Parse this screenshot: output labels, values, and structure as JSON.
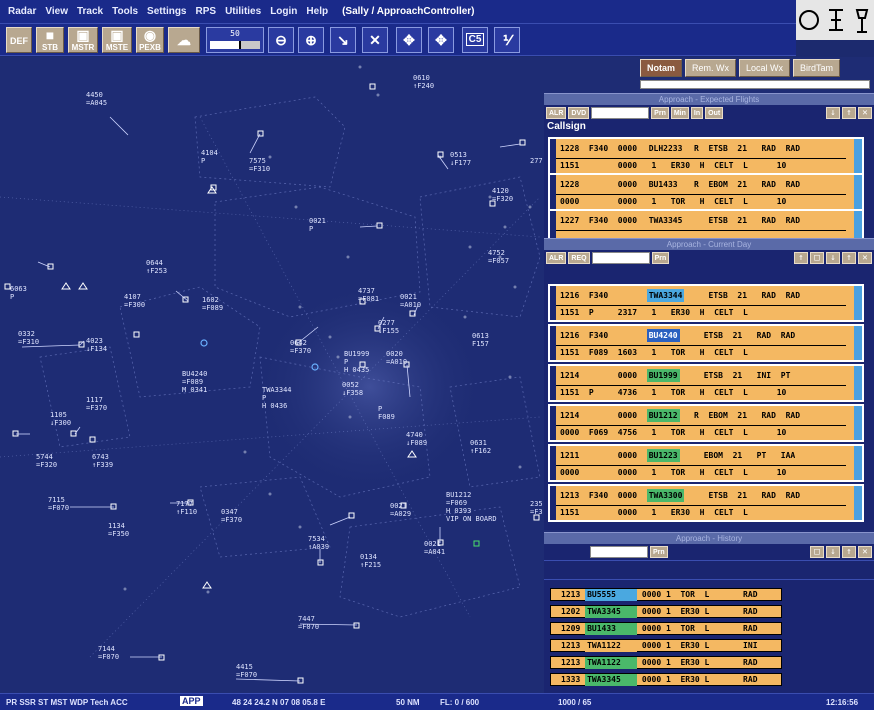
{
  "menu": {
    "items": [
      "Radar",
      "View",
      "Track",
      "Tools",
      "Settings",
      "RPS",
      "Utilities",
      "Login",
      "Help"
    ],
    "window_title": "(Sally / ApproachController)"
  },
  "toolbar": {
    "buttons": [
      {
        "label": "DEF",
        "icon": "def-icon"
      },
      {
        "label": "STB",
        "icon": "stb-icon"
      },
      {
        "label": "MSTR",
        "icon": "mstr-icon"
      },
      {
        "label": "MSTE",
        "icon": "mste-icon"
      },
      {
        "label": "PEXB",
        "icon": "pexb-icon"
      }
    ],
    "zoom_value": "50",
    "zoom_fraction": 0.62
  },
  "notam_bar": {
    "buttons": [
      "Notam",
      "Rem. Wx",
      "Local Wx",
      "BirdTam"
    ]
  },
  "expected": {
    "title": "Approach - Expected Flights",
    "buttons": [
      "ALR",
      "DVD",
      "Prn",
      "Min",
      "In",
      "Out"
    ],
    "callsign_header": "Callsign",
    "strips": [
      {
        "l1a": "1228  F340  0000  ",
        "callsign": "DLH2233",
        "l1b": "  R  ETSB  21   RAD  RAD",
        "l2": "1151        0000   1   ER30  H  CELT  L      10",
        "cs_style": "org"
      },
      {
        "l1a": "1228        0000  ",
        "callsign": "BU1433",
        "l1b": "   R  EBOM  21   RAD  RAD",
        "l2": "0000        0000   1   TOR   H  CELT  L      10",
        "cs_style": "org"
      },
      {
        "l1a": "1227  F340  0000  ",
        "callsign": "TWA3345",
        "l1b": "     ETSB  21   RAD  RAD",
        "l2": "",
        "cs_style": "org"
      }
    ]
  },
  "current": {
    "title": "Approach - Current Day",
    "buttons": [
      "ALR",
      "REQ",
      "Prn"
    ],
    "strips": [
      {
        "l1a": "1216  F340        ",
        "callsign": "TWA3344",
        "l1b": "     ETSB  21   RAD  RAD",
        "l2": "1151  P     2317   1   ER30  H  CELT  L",
        "cs_style": "blue"
      },
      {
        "l1a": "1216  F340        ",
        "callsign": "BU4240",
        "l1b": "     ETSB  21   RAD  RAD",
        "l2": "1151  F089  1603   1   TOR   H  CELT  L",
        "cs_style": "sel"
      },
      {
        "l1a": "1214        0000  ",
        "callsign": "BU1999",
        "l1b": "     ETSB  21   INI  PT",
        "l2": "1151  P     4736   1   TOR   H  CELT  L      10",
        "cs_style": "green"
      },
      {
        "l1a": "1214        0000  ",
        "callsign": "BU1212",
        "l1b": "   R  EBOM  21   RAD  RAD",
        "l2": "0000  F069  4756   1   TOR   H  CELT  L      10",
        "cs_style": "green"
      },
      {
        "l1a": "1211        0000  ",
        "callsign": "BU1223",
        "l1b": "     EBOM  21   PT   IAA",
        "l2": "0000        0000   1   TOR   H  CELT  L      10",
        "cs_style": "green"
      },
      {
        "l1a": "1213  F340  0000  ",
        "callsign": "TWA3300",
        "l1b": "     ETSB  21   RAD  RAD",
        "l2": "1151        0000   1   ER30  H  CELT  L",
        "cs_style": "green"
      }
    ]
  },
  "history": {
    "title": "Approach - History",
    "buttons": [
      "Prn"
    ],
    "rows": [
      {
        "time": "1213",
        "callsign": "BU5555",
        "rest": " 0000 1  TOR  L       RAD",
        "style": ""
      },
      {
        "time": "1202",
        "callsign": "TWA3345",
        "rest": " 0000 1  ER30 L       RAD",
        "style": "green"
      },
      {
        "time": "1209",
        "callsign": "BU1433",
        "rest": " 0000 1  TOR  L       RAD",
        "style": "green"
      },
      {
        "time": "1213",
        "callsign": "TWA1122",
        "rest": " 0000 1  ER30 L       INI",
        "style": "org"
      },
      {
        "time": "1213",
        "callsign": "TWA1122",
        "rest": " 0000 1  ER30 L       RAD",
        "style": "green"
      },
      {
        "time": "1333",
        "callsign": "TWA3345",
        "rest": " 0000 1  ER30 L       RAD",
        "style": "green"
      }
    ]
  },
  "radar_tags": [
    "4450\n=A045",
    "0610\n↑F240",
    "4104\nP",
    "7575\n=F310",
    "0513\n↓F177",
    "277",
    "4120\n=F320",
    "0021\nP",
    "4752\n=F057",
    "0644\n↑F253",
    "4107\n=F300",
    "1602\n=F089",
    "4737\n=F081",
    "0021\n=A010",
    "6063\nP",
    "0332\n=F310",
    "4023\n↓F134",
    "0277\n↓F155",
    "0613\nF157",
    "0642\n=F370",
    "BU1999\nP\nH 0435",
    "0020\n=A010",
    "BU4240\n=F089\nM 0341",
    "TWA3344\nP\nH 0436",
    "0052\n↓F358",
    "P\nF089",
    "1117\n=F370",
    "1105\n↓F300",
    "4740\n↓F089",
    "5744\n=F320",
    "6743\n↑F339",
    "0631\n↑F162",
    "7115\n=F070",
    "7177\n↑F110",
    "0347\n=F370",
    "0021\n=A029",
    "BU1212\n=F069\nH 0393\nVIP ON BOARD",
    "1134\n=F350",
    "7534\n↑A039",
    "0134\n↑F215",
    "0021\n=A041",
    "7447\n=F070",
    "7144\n=F070",
    "4415\n=F070",
    "235\n=F3"
  ],
  "status": {
    "modes": "PR  SSR  ST  MST  WDP  Tech  ACC",
    "app": "APP",
    "position": "48 24 24.2 N 07 08 05.8 E",
    "range": "50 NM",
    "fl": "FL:   0 / 600",
    "count": "1000 / 65",
    "time": "12:16:56"
  }
}
